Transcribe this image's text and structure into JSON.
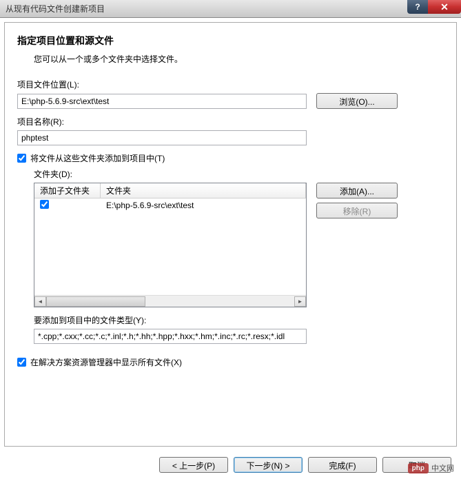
{
  "titlebar": {
    "title": "从现有代码文件创建新项目",
    "help": "?",
    "close": "✕"
  },
  "heading": "指定项目位置和源文件",
  "subheading": "您可以从一个或多个文件夹中选择文件。",
  "location": {
    "label": "项目文件位置(L):",
    "value": "E:\\php-5.6.9-src\\ext\\test",
    "browse": "浏览(O)..."
  },
  "name": {
    "label": "项目名称(R):",
    "value": "phptest"
  },
  "add_folders": {
    "checkbox_label": "将文件从这些文件夹添加到项目中(T)",
    "folder_label": "文件夹(D):",
    "col_subfolders": "添加子文件夹",
    "col_folder": "文件夹",
    "rows": [
      {
        "checked": true,
        "path": "E:\\php-5.6.9-src\\ext\\test"
      }
    ],
    "add_btn": "添加(A)...",
    "remove_btn": "移除(R)"
  },
  "filetypes": {
    "label": "要添加到项目中的文件类型(Y):",
    "value": "*.cpp;*.cxx;*.cc;*.c;*.inl;*.h;*.hh;*.hpp;*.hxx;*.hm;*.inc;*.rc;*.resx;*.idl"
  },
  "show_all": {
    "label": "在解决方案资源管理器中显示所有文件(X)"
  },
  "buttons": {
    "prev": "< 上一步(P)",
    "next": "下一步(N) >",
    "finish": "完成(F)",
    "cancel": "取消"
  },
  "watermark": {
    "badge": "php",
    "text": "中文网"
  }
}
